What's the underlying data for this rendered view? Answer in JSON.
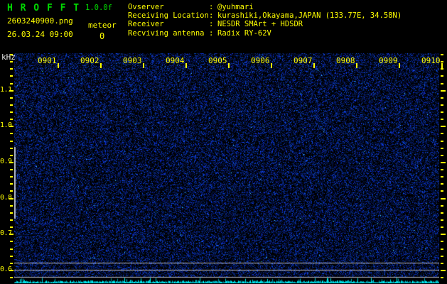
{
  "app": {
    "title": "H R O F F T",
    "version": "1.0.0f"
  },
  "session": {
    "filename": "2603240900.png",
    "datetime": "26.03.24 09:00",
    "meteor_label": "meteor",
    "meteor_count": "0"
  },
  "info": {
    "separator": ":",
    "rows": [
      {
        "label": "Ovserver",
        "value": "@yuhmari"
      },
      {
        "label": "Receiving Location",
        "value": "kurashiki,Okayama,JAPAN (133.77E, 34.58N)"
      },
      {
        "label": "Receiver",
        "value": "NESDR SMArt + HDSDR"
      },
      {
        "label": "Recviving antenna",
        "value": "Radix RY-62V"
      }
    ]
  },
  "axis": {
    "unit_label": "kHz",
    "time_labels": [
      "0901",
      "0902",
      "0903",
      "0904",
      "0905",
      "0906",
      "0907",
      "0908",
      "0909",
      "0910"
    ],
    "freq_labels": [
      "1.1",
      "1.0",
      "0.9",
      "0.8",
      "0.7",
      "0.6"
    ]
  },
  "colors": {
    "accent_green": "#00d900",
    "text_yellow": "#ffff00",
    "axis_white": "#e8e8e8",
    "signal_cyan": "#00e5ff",
    "noise_blue": "#1e2fb4"
  }
}
